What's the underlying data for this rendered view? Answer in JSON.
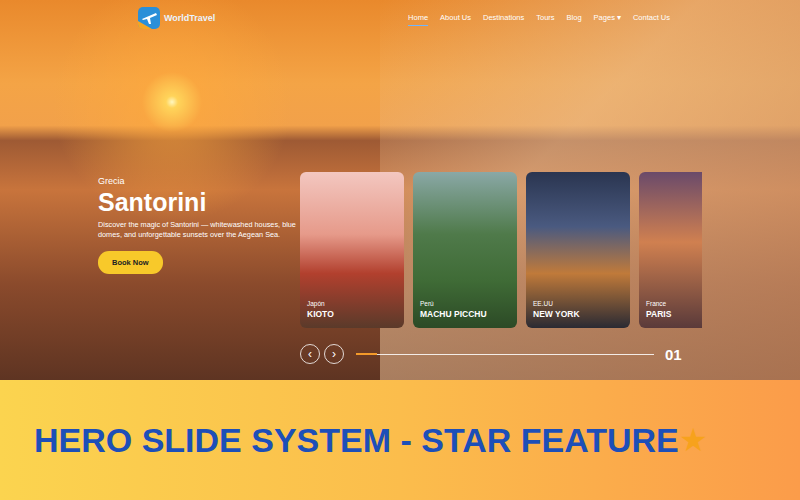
{
  "logo": {
    "text": "WorldTravel"
  },
  "nav": [
    {
      "label": "Home",
      "selected": true
    },
    {
      "label": "About Us",
      "selected": false
    },
    {
      "label": "Destinations",
      "selected": false
    },
    {
      "label": "Tours",
      "selected": false
    },
    {
      "label": "Blog",
      "selected": false
    },
    {
      "label": "Pages",
      "caret": "▾",
      "selected": false
    },
    {
      "label": "Contact Us",
      "selected": false
    }
  ],
  "hero": {
    "country": "Grecia",
    "title": "Santorini",
    "description": "Discover the magic of Santorini — whitewashed houses, blue domes, and unforgettable sunsets over the Aegean Sea.",
    "button": "Book Now"
  },
  "cards": [
    {
      "country": "Japón",
      "city": "KIOTO"
    },
    {
      "country": "Perú",
      "city": "MACHU PICCHU"
    },
    {
      "country": "EE.UU",
      "city": "NEW YORK"
    },
    {
      "country": "France",
      "city": "PARIS"
    }
  ],
  "slider": {
    "prev": "‹",
    "next": "›",
    "level": 0.07,
    "counter": "01"
  },
  "banner": {
    "text": "HERO SLIDE SYSTEM - STAR FEATURE",
    "star": "★"
  }
}
